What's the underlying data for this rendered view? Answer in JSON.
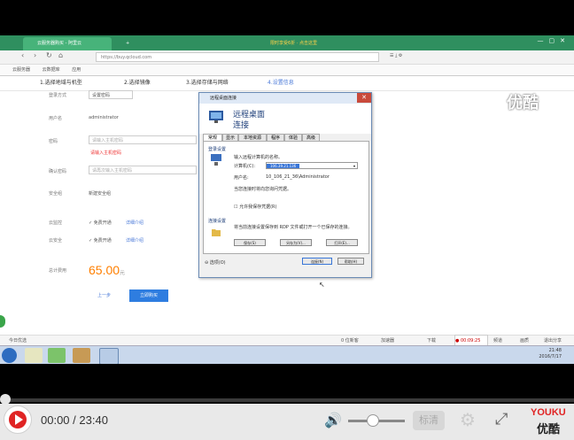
{
  "browser": {
    "tab1": "云服务器购买 - 阿里云",
    "tab_center_text": "限时享受6折 · 点击这里",
    "url": "https://buy.qcloud.com",
    "back_icon": "arrow-left-icon",
    "forward_icon": "arrow-right-icon",
    "refresh_icon": "refresh-icon",
    "bookmarks": [
      "云服务器",
      "云数据库",
      "应用"
    ]
  },
  "steps": [
    "1.选择地域与机型",
    "2.选择镜像",
    "3.选择存储与网络",
    "4.设置信息"
  ],
  "form": {
    "rows": [
      {
        "label": "登录方式",
        "value": "设置密码"
      },
      {
        "label": "用户名",
        "value": "administrator"
      },
      {
        "label": "密码",
        "placeholder": "请输入主机密码",
        "error": "请输入主机密码"
      },
      {
        "label": "确认密码",
        "placeholder": "请再次输入主机密码"
      },
      {
        "label": "安全组",
        "value": "新建安全组"
      },
      {
        "label": "云监控",
        "value": "免费开通",
        "link": "详细介绍"
      },
      {
        "label": "云安全",
        "value": "免费开通",
        "link": "详细介绍"
      }
    ],
    "price_label": "总计费用",
    "price": "65.00",
    "price_unit": "元",
    "prev_button": "上一步",
    "buy_button": "立即购买"
  },
  "dialog": {
    "title": "远程桌面连接",
    "heading1": "远程桌面",
    "heading2": "连接",
    "tabs": [
      "常规",
      "显示",
      "本地资源",
      "程序",
      "体验",
      "高级"
    ],
    "login_group": "登录设置",
    "login_hint": "输入远程计算机的名称。",
    "computer_label": "计算机(C):",
    "computer_value": "106.39.21.136",
    "user_label": "用户名:",
    "user_value": "10_106_21_36\\Administrator",
    "save_hint": "当您连接时将向您询问凭据。",
    "remember_label": "允许我保存凭据(R)",
    "conn_group": "连接设置",
    "conn_hint": "将当前连接设置保存到 RDP 文件或打开一个已保存的连接。",
    "save_btn": "保存(S)",
    "saveas_btn": "另存为(V)...",
    "open_btn": "打开(E)...",
    "options_btn": "选项(O)",
    "connect_btn": "连接(N)",
    "help_btn": "帮助(H)"
  },
  "statusbar": {
    "left": "今日优选",
    "items": [
      "0 位新客",
      "加速器",
      "下载"
    ],
    "timer": "00:09:25",
    "btn1": "频道",
    "btn2": "画质",
    "btn3": "退出分享"
  },
  "taskbar": {
    "time": "21:48",
    "date": "2016/7/17"
  },
  "watermark": "优酷",
  "player": {
    "time_current": "00:00",
    "time_separator": " / ",
    "time_total": "23:40",
    "progress": 0.0,
    "volume": 0.35,
    "quality_label": "标清",
    "logo_top": "YOUKU",
    "logo_bottom": "优酷",
    "play_icon": "play-icon",
    "volume_icon": "volume-icon",
    "settings_icon": "gear-icon",
    "fullscreen_icon": "fullscreen-icon"
  },
  "colors": {
    "accent_blue": "#2e7de0",
    "price_orange": "#ff7f00",
    "play_red": "#e02424"
  }
}
